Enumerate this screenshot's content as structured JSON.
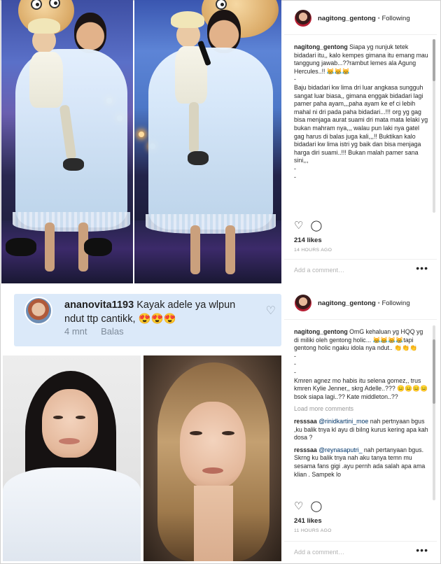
{
  "card": {
    "username": "ananovita1193",
    "text": "Kayak adele ya wlpun ndut ttp cantikk, 😍😍😍",
    "time": "4 mnt",
    "reply": "Balas"
  },
  "post1": {
    "username": "nagitong_gentong",
    "bullet": "•",
    "following": "Following",
    "caption": [
      {
        "user": "nagitong_gentong",
        "text": " Siapa yg nunjuk tetek bidadari itu,, kalo kempes gimana itu emang mau tanggung jawab...??rambut lemes ala Agung Hercules..!! 😹😹😹"
      },
      {
        "text": "-"
      },
      {
        "text": "Baju bidadari kw lima dri luar angkasa sungguh sangat luar biasa,, gimana enggak bidadari lagi pamer paha ayam,,,paha ayam ke ef ci lebih mahal ni dri pada paha bidadari...!!! org yg gag bisa menjaga aurat suami dri mata mata lelaki yg bukan mahram nya,,, walau pun laki nya gatel gag harus di balas juga kali,,,!! Buktikan kalo bidadari kw lima istri yg baik dan bisa menjaga harga diri suami..!!! Bukan malah pamer sana sini,,,"
      },
      {
        "text": "-"
      },
      {
        "text": "-"
      }
    ],
    "likes": "214 likes",
    "time": "14 HOURS AGO",
    "add_comment": "Add a comment…",
    "more": "•••"
  },
  "post2": {
    "username": "nagitong_gentong",
    "bullet": "•",
    "following": "Following",
    "caption": [
      {
        "user": "nagitong_gentong",
        "text": " OmG kehaluan yg HQQ yg di miliki oleh gentong holic... 😹😹😹😹tapi gentong holic ngaku idola nya ndut.. 👏👏👏"
      },
      {
        "text": "-"
      },
      {
        "text": "-"
      },
      {
        "text": "-"
      },
      {
        "text": "Kmren agnez mo habis itu selena gomez,, trus kmren Kylie Jenner,, skrg Adelle..??? 😑😑😑😑 bsok siapa lagi..?? Kate middleton..??"
      }
    ],
    "load_more": "Load more comments",
    "comments": [
      {
        "user": "resssaa",
        "mention": "@rinidkartini_moe",
        "text": " nah pertnyaan bgus ,ku balik tnya kl ayu di biIng kurus kering apa kah dosa ?"
      },
      {
        "user": "resssaa",
        "mention": "@reynasaputri_",
        "text": " nah pertanyaan bgus. Skrng ku balik tnya nah aku tanya temn mu sesama fans gigi .ayu pernh ada salah apa ama klian . Sampek lo"
      }
    ],
    "likes": "241 likes",
    "time": "11 HOURS AGO",
    "add_comment": "Add a comment…",
    "more": "•••"
  },
  "icons": [
    "heart-icon",
    "comment-icon",
    "more-icon"
  ]
}
